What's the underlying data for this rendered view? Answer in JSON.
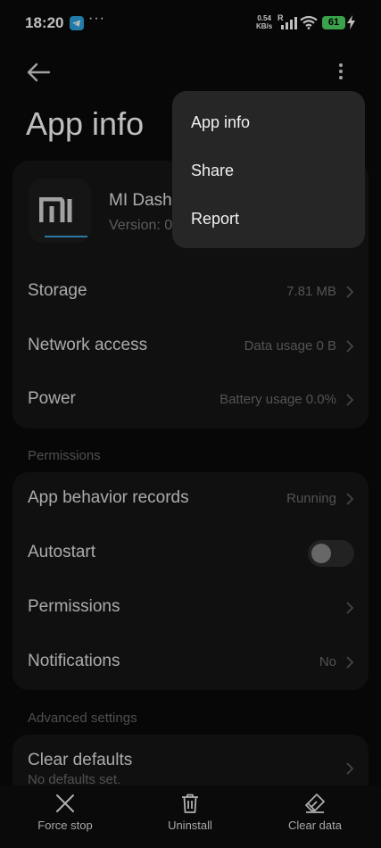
{
  "status_bar": {
    "time": "18:20",
    "more_dots": "···",
    "net_speed_value": "0.54",
    "net_speed_unit": "KB/s",
    "roaming": "R",
    "battery_level": "61",
    "battery_color": "#4cd964"
  },
  "header": {
    "title": "App info"
  },
  "app": {
    "name": "MI Dash",
    "version": "Version: 0"
  },
  "main_rows": [
    {
      "label": "Storage",
      "value": "7.81 MB"
    },
    {
      "label": "Network access",
      "value": "Data usage 0 B"
    },
    {
      "label": "Power",
      "value": "Battery usage 0.0%"
    }
  ],
  "permissions_section": {
    "title": "Permissions",
    "rows": [
      {
        "label": "App behavior records",
        "value": "Running"
      },
      {
        "label": "Autostart",
        "toggle_on": false
      },
      {
        "label": "Permissions",
        "value": ""
      },
      {
        "label": "Notifications",
        "value": "No"
      }
    ]
  },
  "advanced_section": {
    "title": "Advanced settings",
    "clear_defaults": {
      "label": "Clear defaults",
      "sub": "No defaults set."
    }
  },
  "overflow_menu": {
    "items": [
      "App info",
      "Share",
      "Report"
    ]
  },
  "bottom_bar": {
    "force_stop": "Force stop",
    "uninstall": "Uninstall",
    "clear_data": "Clear data"
  },
  "icons": {
    "back": "back-arrow-icon",
    "more": "more-vertical-icon",
    "chevron": "chevron-right-icon",
    "force_stop": "close-icon",
    "uninstall": "trash-icon",
    "clear_data": "eraser-icon"
  }
}
